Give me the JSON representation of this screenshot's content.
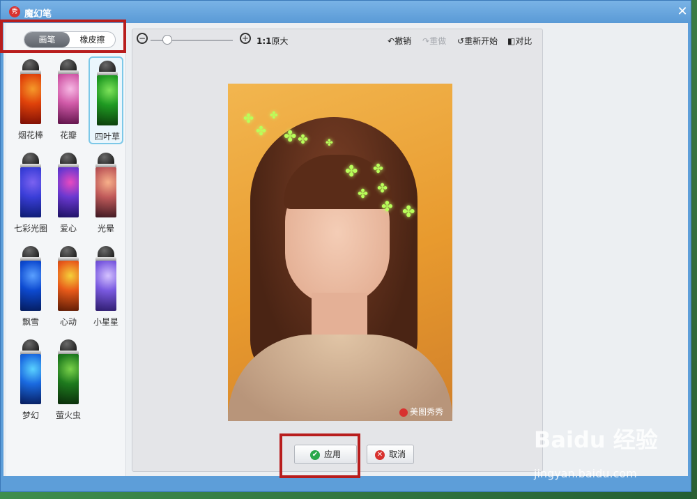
{
  "window": {
    "title": "魔幻笔",
    "app_icon_glyph": "秀",
    "close_glyph": "✕"
  },
  "mode_tabs": [
    {
      "label": "画笔",
      "active": true
    },
    {
      "label": "橡皮擦",
      "active": false
    }
  ],
  "brushes": [
    {
      "label": "烟花棒",
      "colors": [
        "#7a0d05",
        "#e0420a",
        "#f59a2a"
      ]
    },
    {
      "label": "花瓣",
      "colors": [
        "#5b1046",
        "#d15aa8",
        "#f7b9e4"
      ]
    },
    {
      "label": "四叶草",
      "colors": [
        "#0b3a0b",
        "#1f9a22",
        "#7ee35a"
      ],
      "selected": true
    },
    {
      "label": "七彩光圈",
      "colors": [
        "#0b1a6e",
        "#3a3ed8",
        "#7b62f0"
      ]
    },
    {
      "label": "爱心",
      "colors": [
        "#1a1060",
        "#6a38d0",
        "#e84ac0"
      ]
    },
    {
      "label": "光晕",
      "colors": [
        "#3a1620",
        "#c05a5a",
        "#f7b08a"
      ]
    },
    {
      "label": "飘雪",
      "colors": [
        "#041a5a",
        "#0d4ad0",
        "#5aa0ff"
      ]
    },
    {
      "label": "心动",
      "colors": [
        "#5a1a05",
        "#e85a1a",
        "#f5d03a"
      ]
    },
    {
      "label": "小星星",
      "colors": [
        "#2b1a6a",
        "#7a5ae0",
        "#d4c2ff"
      ]
    },
    {
      "label": "梦幻",
      "colors": [
        "#061a5a",
        "#1a6ae0",
        "#5ad2ff"
      ]
    },
    {
      "label": "萤火虫",
      "colors": [
        "#0a2a0a",
        "#1e7a1e",
        "#7ad24a"
      ]
    }
  ],
  "toolbar": {
    "zoom_out_icon": "−",
    "zoom_in_icon": "+",
    "actual_size_prefix": "1:1",
    "actual_size": "原大",
    "undo": "撤销",
    "redo": "重做",
    "restart": "重新开始",
    "compare": "对比",
    "zoom_level_fraction": 0.2
  },
  "photo": {
    "watermark": "美图秀秀"
  },
  "actions": {
    "apply": "应用",
    "cancel": "取消"
  },
  "overlay_watermark": {
    "brand": "Baidu 经验",
    "url": "jingyan.baidu.com"
  },
  "colors": {
    "highlight_red": "#b81d1d",
    "selected_border": "#7cc8e8",
    "apply_icon": "#2aa84a",
    "cancel_icon": "#d8322f"
  }
}
